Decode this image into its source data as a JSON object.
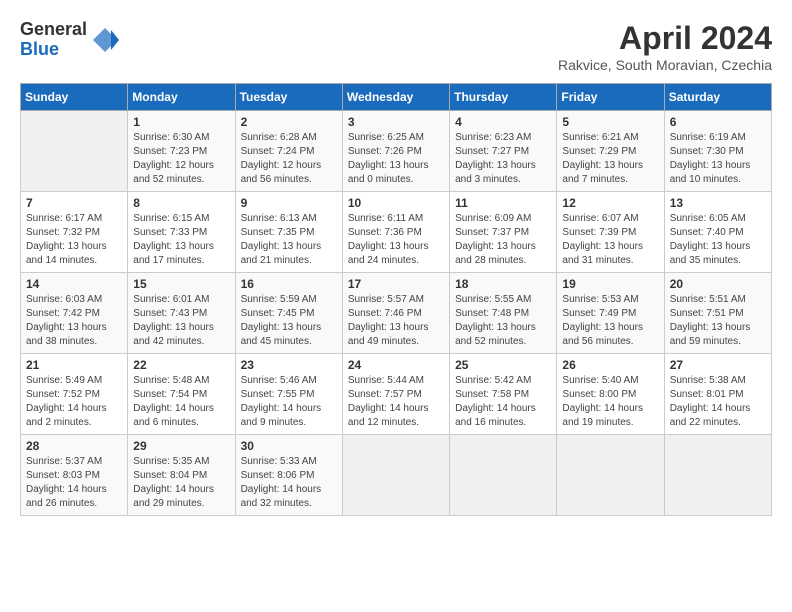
{
  "logo": {
    "general": "General",
    "blue": "Blue"
  },
  "title": "April 2024",
  "subtitle": "Rakvice, South Moravian, Czechia",
  "calendar": {
    "headers": [
      "Sunday",
      "Monday",
      "Tuesday",
      "Wednesday",
      "Thursday",
      "Friday",
      "Saturday"
    ],
    "rows": [
      [
        {
          "day": "",
          "info": ""
        },
        {
          "day": "1",
          "info": "Sunrise: 6:30 AM\nSunset: 7:23 PM\nDaylight: 12 hours\nand 52 minutes."
        },
        {
          "day": "2",
          "info": "Sunrise: 6:28 AM\nSunset: 7:24 PM\nDaylight: 12 hours\nand 56 minutes."
        },
        {
          "day": "3",
          "info": "Sunrise: 6:25 AM\nSunset: 7:26 PM\nDaylight: 13 hours\nand 0 minutes."
        },
        {
          "day": "4",
          "info": "Sunrise: 6:23 AM\nSunset: 7:27 PM\nDaylight: 13 hours\nand 3 minutes."
        },
        {
          "day": "5",
          "info": "Sunrise: 6:21 AM\nSunset: 7:29 PM\nDaylight: 13 hours\nand 7 minutes."
        },
        {
          "day": "6",
          "info": "Sunrise: 6:19 AM\nSunset: 7:30 PM\nDaylight: 13 hours\nand 10 minutes."
        }
      ],
      [
        {
          "day": "7",
          "info": "Sunrise: 6:17 AM\nSunset: 7:32 PM\nDaylight: 13 hours\nand 14 minutes."
        },
        {
          "day": "8",
          "info": "Sunrise: 6:15 AM\nSunset: 7:33 PM\nDaylight: 13 hours\nand 17 minutes."
        },
        {
          "day": "9",
          "info": "Sunrise: 6:13 AM\nSunset: 7:35 PM\nDaylight: 13 hours\nand 21 minutes."
        },
        {
          "day": "10",
          "info": "Sunrise: 6:11 AM\nSunset: 7:36 PM\nDaylight: 13 hours\nand 24 minutes."
        },
        {
          "day": "11",
          "info": "Sunrise: 6:09 AM\nSunset: 7:37 PM\nDaylight: 13 hours\nand 28 minutes."
        },
        {
          "day": "12",
          "info": "Sunrise: 6:07 AM\nSunset: 7:39 PM\nDaylight: 13 hours\nand 31 minutes."
        },
        {
          "day": "13",
          "info": "Sunrise: 6:05 AM\nSunset: 7:40 PM\nDaylight: 13 hours\nand 35 minutes."
        }
      ],
      [
        {
          "day": "14",
          "info": "Sunrise: 6:03 AM\nSunset: 7:42 PM\nDaylight: 13 hours\nand 38 minutes."
        },
        {
          "day": "15",
          "info": "Sunrise: 6:01 AM\nSunset: 7:43 PM\nDaylight: 13 hours\nand 42 minutes."
        },
        {
          "day": "16",
          "info": "Sunrise: 5:59 AM\nSunset: 7:45 PM\nDaylight: 13 hours\nand 45 minutes."
        },
        {
          "day": "17",
          "info": "Sunrise: 5:57 AM\nSunset: 7:46 PM\nDaylight: 13 hours\nand 49 minutes."
        },
        {
          "day": "18",
          "info": "Sunrise: 5:55 AM\nSunset: 7:48 PM\nDaylight: 13 hours\nand 52 minutes."
        },
        {
          "day": "19",
          "info": "Sunrise: 5:53 AM\nSunset: 7:49 PM\nDaylight: 13 hours\nand 56 minutes."
        },
        {
          "day": "20",
          "info": "Sunrise: 5:51 AM\nSunset: 7:51 PM\nDaylight: 13 hours\nand 59 minutes."
        }
      ],
      [
        {
          "day": "21",
          "info": "Sunrise: 5:49 AM\nSunset: 7:52 PM\nDaylight: 14 hours\nand 2 minutes."
        },
        {
          "day": "22",
          "info": "Sunrise: 5:48 AM\nSunset: 7:54 PM\nDaylight: 14 hours\nand 6 minutes."
        },
        {
          "day": "23",
          "info": "Sunrise: 5:46 AM\nSunset: 7:55 PM\nDaylight: 14 hours\nand 9 minutes."
        },
        {
          "day": "24",
          "info": "Sunrise: 5:44 AM\nSunset: 7:57 PM\nDaylight: 14 hours\nand 12 minutes."
        },
        {
          "day": "25",
          "info": "Sunrise: 5:42 AM\nSunset: 7:58 PM\nDaylight: 14 hours\nand 16 minutes."
        },
        {
          "day": "26",
          "info": "Sunrise: 5:40 AM\nSunset: 8:00 PM\nDaylight: 14 hours\nand 19 minutes."
        },
        {
          "day": "27",
          "info": "Sunrise: 5:38 AM\nSunset: 8:01 PM\nDaylight: 14 hours\nand 22 minutes."
        }
      ],
      [
        {
          "day": "28",
          "info": "Sunrise: 5:37 AM\nSunset: 8:03 PM\nDaylight: 14 hours\nand 26 minutes."
        },
        {
          "day": "29",
          "info": "Sunrise: 5:35 AM\nSunset: 8:04 PM\nDaylight: 14 hours\nand 29 minutes."
        },
        {
          "day": "30",
          "info": "Sunrise: 5:33 AM\nSunset: 8:06 PM\nDaylight: 14 hours\nand 32 minutes."
        },
        {
          "day": "",
          "info": ""
        },
        {
          "day": "",
          "info": ""
        },
        {
          "day": "",
          "info": ""
        },
        {
          "day": "",
          "info": ""
        }
      ]
    ]
  }
}
